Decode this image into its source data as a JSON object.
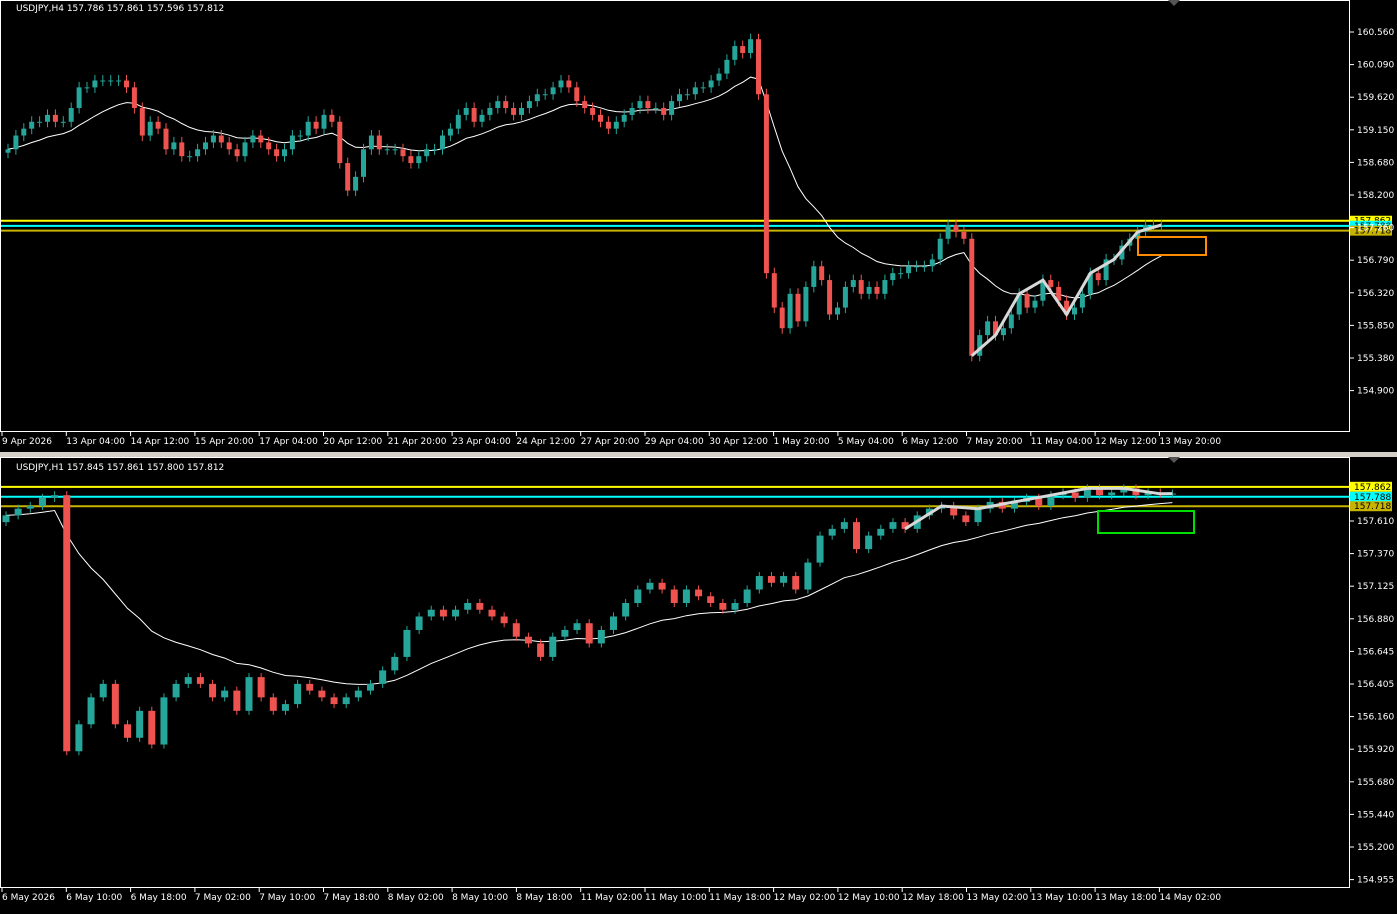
{
  "colors": {
    "background": "#000000",
    "frame": "#ffffff",
    "bull": "#26a69a",
    "bear": "#ef5350",
    "ma": "#ffffff",
    "level_yellow": "#ffff00",
    "level_cyan": "#00ffff",
    "level_olive": "#c8b400",
    "box_orange": "#ff8c00",
    "box_green": "#00dd00",
    "zigzag": "#d8d8d8",
    "bid_label_bg": "#00ffff"
  },
  "charts": [
    {
      "id": "h4",
      "title": "USDJPY,H4  157.786 157.861 157.596 157.812",
      "y_ticks": [
        "160.560",
        "160.090",
        "159.620",
        "159.150",
        "158.680",
        "158.200",
        "157.260",
        "156.790",
        "156.320",
        "155.850",
        "155.380",
        "154.900"
      ],
      "price_labels": [
        {
          "text": "157.862",
          "color": "#ffff00"
        },
        {
          "text": "157.788",
          "color": "#00ffff"
        },
        {
          "text": "157.718",
          "color": "#c8b400"
        }
      ],
      "x_ticks": [
        "9 Apr 2026",
        "13 Apr 04:00",
        "14 Apr 12:00",
        "15 Apr 20:00",
        "17 Apr 04:00",
        "20 Apr 12:00",
        "21 Apr 20:00",
        "23 Apr 04:00",
        "24 Apr 12:00",
        "27 Apr 20:00",
        "29 Apr 04:00",
        "30 Apr 12:00",
        "1 May 20:00",
        "5 May 04:00",
        "6 May 12:00",
        "7 May 20:00",
        "11 May 04:00",
        "12 May 12:00",
        "13 May 20:00"
      ]
    },
    {
      "id": "h1",
      "title": "USDJPY,H1  157.845 157.861 157.800 157.812",
      "y_ticks": [
        "157.610",
        "157.370",
        "157.125",
        "156.880",
        "156.645",
        "156.405",
        "156.160",
        "155.920",
        "155.680",
        "155.440",
        "155.200",
        "154.955"
      ],
      "price_labels": [
        {
          "text": "157.862",
          "color": "#ffff00"
        },
        {
          "text": "157.788",
          "color": "#00ffff"
        },
        {
          "text": "157.718",
          "color": "#c8b400"
        }
      ],
      "x_ticks": [
        "6 May 2026",
        "6 May 10:00",
        "6 May 18:00",
        "7 May 02:00",
        "7 May 10:00",
        "7 May 18:00",
        "8 May 02:00",
        "8 May 10:00",
        "8 May 18:00",
        "11 May 02:00",
        "11 May 10:00",
        "11 May 18:00",
        "12 May 02:00",
        "12 May 10:00",
        "12 May 18:00",
        "13 May 02:00",
        "13 May 10:00",
        "13 May 18:00",
        "14 May 02:00"
      ]
    }
  ],
  "chart_data": [
    {
      "type": "candlestick",
      "symbol": "USDJPY",
      "timeframe": "H4",
      "ylim": [
        154.85,
        160.75
      ],
      "levels": [
        157.862,
        157.788,
        157.718
      ],
      "close": [
        158.9,
        159.1,
        159.2,
        159.3,
        159.3,
        159.4,
        159.3,
        159.3,
        159.5,
        159.8,
        159.8,
        159.9,
        159.9,
        159.9,
        159.9,
        159.8,
        159.5,
        159.1,
        159.3,
        159.2,
        158.9,
        159.0,
        158.8,
        158.8,
        158.9,
        159.0,
        159.1,
        159.0,
        158.9,
        158.8,
        159.0,
        159.1,
        159.0,
        158.9,
        158.8,
        158.9,
        159.1,
        159.1,
        159.3,
        159.2,
        159.4,
        159.3,
        158.7,
        158.3,
        158.5,
        158.9,
        159.1,
        158.9,
        158.9,
        158.9,
        158.8,
        158.7,
        158.8,
        158.9,
        158.9,
        159.1,
        159.2,
        159.4,
        159.5,
        159.3,
        159.4,
        159.5,
        159.6,
        159.5,
        159.4,
        159.5,
        159.6,
        159.7,
        159.7,
        159.8,
        159.9,
        159.8,
        159.6,
        159.5,
        159.4,
        159.3,
        159.2,
        159.3,
        159.4,
        159.5,
        159.6,
        159.5,
        159.5,
        159.4,
        159.6,
        159.7,
        159.7,
        159.8,
        159.8,
        159.9,
        160.0,
        160.2,
        160.4,
        160.3,
        160.5,
        159.7,
        157.1,
        156.6,
        156.3,
        156.8,
        156.4,
        156.9,
        157.2,
        157.0,
        156.5,
        156.6,
        156.9,
        157.0,
        156.8,
        156.9,
        156.8,
        157.0,
        157.1,
        157.1,
        157.2,
        157.2,
        157.2,
        157.3,
        157.6,
        157.8,
        157.7,
        157.6,
        155.9,
        156.2,
        156.4,
        156.2,
        156.3,
        156.5,
        156.8,
        156.6,
        156.7,
        157.0,
        156.9,
        156.7,
        156.5,
        156.6,
        156.8,
        157.1,
        157.0,
        157.3,
        157.3,
        157.5,
        157.6,
        157.7,
        157.8,
        157.8,
        157.8
      ],
      "ma_description": "white moving average"
    },
    {
      "type": "candlestick",
      "symbol": "USDJPY",
      "timeframe": "H1",
      "ylim": [
        154.93,
        157.92
      ],
      "levels": [
        157.862,
        157.788,
        157.718
      ],
      "close": [
        157.65,
        157.7,
        157.72,
        157.78,
        157.8,
        155.9,
        156.1,
        156.3,
        156.4,
        156.1,
        156.0,
        156.2,
        155.95,
        156.3,
        156.4,
        156.45,
        156.4,
        156.3,
        156.35,
        156.2,
        156.45,
        156.3,
        156.2,
        156.25,
        156.4,
        156.35,
        156.3,
        156.25,
        156.3,
        156.35,
        156.4,
        156.5,
        156.6,
        156.8,
        156.9,
        156.95,
        156.9,
        156.95,
        157.0,
        156.95,
        156.9,
        156.85,
        156.75,
        156.7,
        156.6,
        156.75,
        156.8,
        156.85,
        156.7,
        156.8,
        156.9,
        157.0,
        157.1,
        157.15,
        157.1,
        157.0,
        157.1,
        157.05,
        157.0,
        156.95,
        157.0,
        157.1,
        157.2,
        157.15,
        157.2,
        157.1,
        157.3,
        157.5,
        157.55,
        157.6,
        157.4,
        157.5,
        157.55,
        157.6,
        157.55,
        157.65,
        157.7,
        157.72,
        157.65,
        157.6,
        157.7,
        157.75,
        157.7,
        157.75,
        157.78,
        157.72,
        157.8,
        157.82,
        157.78,
        157.85,
        157.8,
        157.82,
        157.85,
        157.8,
        157.82,
        157.81,
        157.812
      ]
    }
  ]
}
